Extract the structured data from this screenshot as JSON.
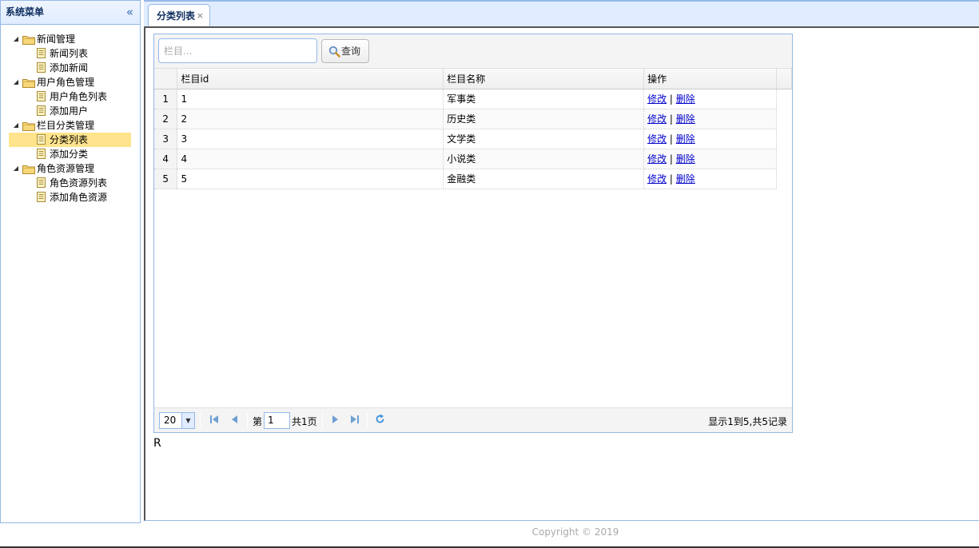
{
  "menu": {
    "title": "系统菜单",
    "collapse_icon": "«",
    "groups": [
      {
        "label": "新闻管理",
        "items": [
          "新闻列表",
          "添加新闻"
        ]
      },
      {
        "label": "用户角色管理",
        "items": [
          "用户角色列表",
          "添加用户"
        ]
      },
      {
        "label": "栏目分类管理",
        "items": [
          "分类列表",
          "添加分类"
        ]
      },
      {
        "label": "角色资源管理",
        "items": [
          "角色资源列表",
          "添加角色资源"
        ]
      }
    ],
    "selected": "分类列表"
  },
  "tab": {
    "label": "分类列表",
    "close": "×"
  },
  "toolbar": {
    "search_placeholder": "栏目...",
    "search_label": "查询"
  },
  "grid": {
    "columns": [
      "栏目id",
      "栏目名称",
      "操作"
    ],
    "rows": [
      {
        "num": "1",
        "id": "1",
        "name": "军事类",
        "edit": "修改",
        "sep": "|",
        "del": "删除"
      },
      {
        "num": "2",
        "id": "2",
        "name": "历史类",
        "edit": "修改",
        "sep": "|",
        "del": "删除"
      },
      {
        "num": "3",
        "id": "3",
        "name": "文学类",
        "edit": "修改",
        "sep": "|",
        "del": "删除"
      },
      {
        "num": "4",
        "id": "4",
        "name": "小说类",
        "edit": "修改",
        "sep": "|",
        "del": "删除"
      },
      {
        "num": "5",
        "id": "5",
        "name": "金融类",
        "edit": "修改",
        "sep": "|",
        "del": "删除"
      }
    ]
  },
  "pager": {
    "page_size": "20",
    "page_prefix": "第",
    "page_value": "1",
    "page_suffix": "共1页",
    "info": "显示1到5,共5记录"
  },
  "stray_text": "R",
  "footer": "Copyright © 2019",
  "colors": {
    "border": "#95b8e7",
    "selected": "#ffe48d",
    "link": "#0000cc"
  }
}
